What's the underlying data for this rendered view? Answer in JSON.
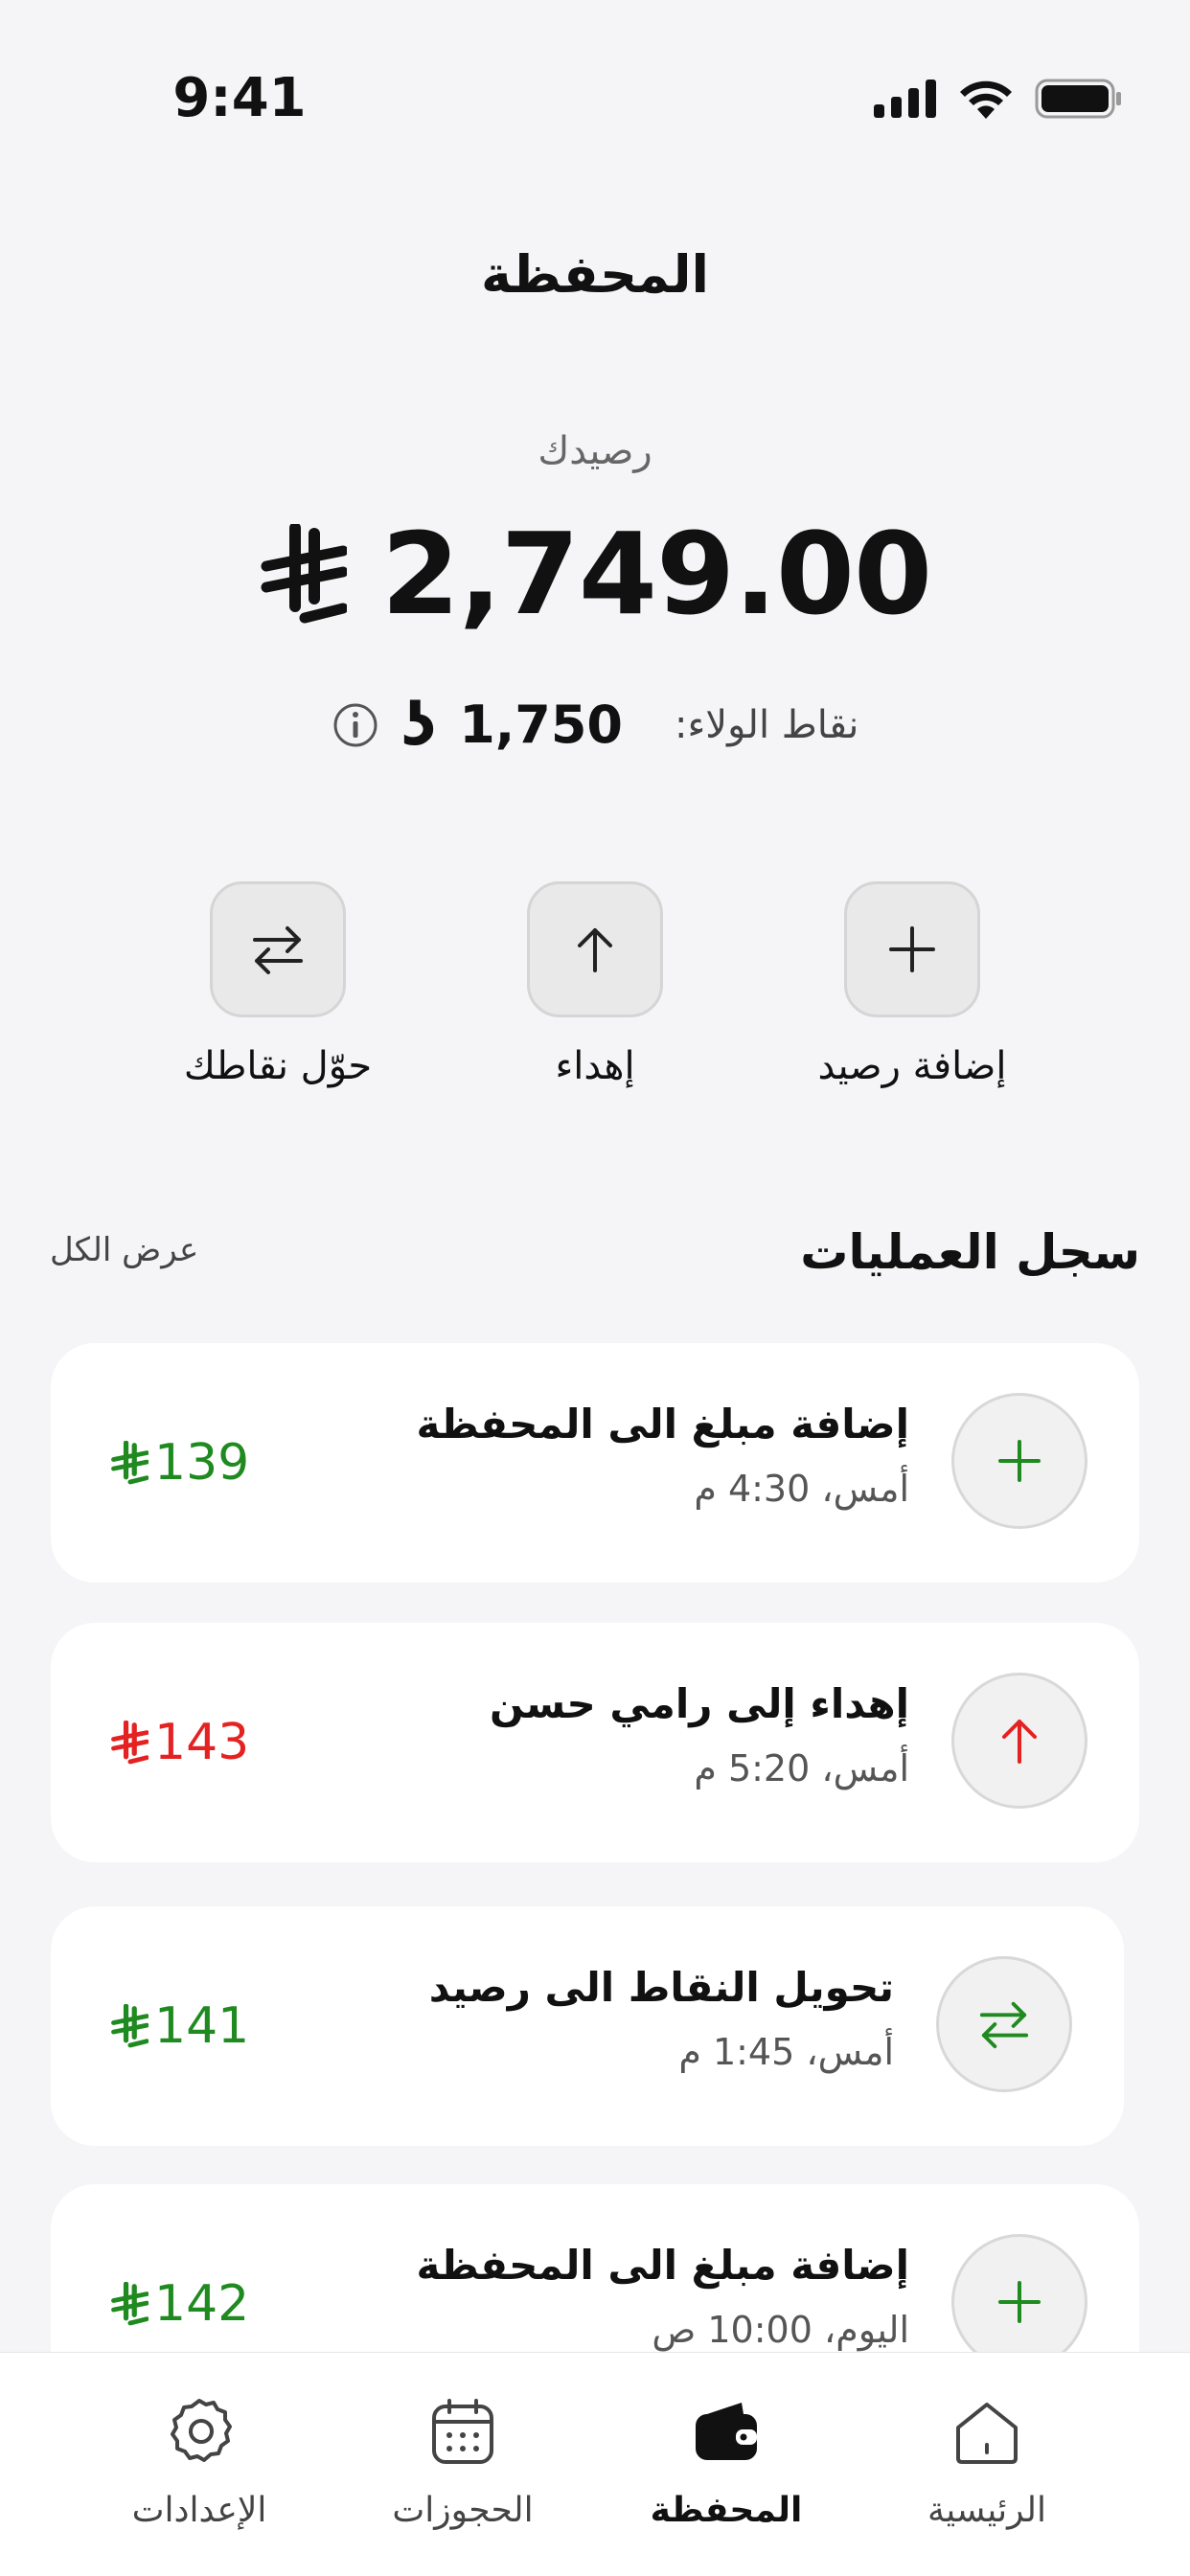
{
  "status_bar": {
    "time": "9:41"
  },
  "header": {
    "title": "المحفظة"
  },
  "balance": {
    "label": "رصيدك",
    "amount": "2,749.00",
    "currency_icon": "riyal-icon",
    "loyalty_label": "نقاط الولاء:",
    "loyalty_value": "1,750",
    "loyalty_symbol": "ʖ"
  },
  "actions": [
    {
      "label": "إضافة رصيد",
      "icon": "plus-icon"
    },
    {
      "label": "إهداء",
      "icon": "arrow-up-icon"
    },
    {
      "label": "حوّل نقاطك",
      "icon": "swap-icon"
    }
  ],
  "history": {
    "title": "سجل العمليات",
    "view_all": "عرض الكل",
    "items": [
      {
        "title": "إضافة مبلغ الى المحفظة",
        "time": "أمس، 4:30 م",
        "amount": "139",
        "type": "credit",
        "icon": "plus-icon",
        "color": "#1F8A1F"
      },
      {
        "title": "إهداء إلى رامي حسن",
        "time": "أمس، 5:20 م",
        "amount": "143",
        "type": "debit",
        "icon": "arrow-up-icon",
        "color": "#E52222"
      },
      {
        "title": "تحويل النقاط الى رصيد",
        "time": "أمس، 1:45 م",
        "amount": "141",
        "type": "credit",
        "icon": "swap-icon",
        "color": "#1F8A1F"
      },
      {
        "title": "إضافة مبلغ الى المحفظة",
        "time": "اليوم، 10:00 ص",
        "amount": "142",
        "type": "credit",
        "icon": "plus-icon",
        "color": "#1F8A1F"
      }
    ]
  },
  "bottom_nav": [
    {
      "label": "الرئيسية",
      "icon": "home-icon",
      "active": false
    },
    {
      "label": "المحفظة",
      "icon": "wallet-icon",
      "active": true
    },
    {
      "label": "الحجوزات",
      "icon": "calendar-icon",
      "active": false
    },
    {
      "label": "الإعدادات",
      "icon": "gear-icon",
      "active": false
    }
  ]
}
